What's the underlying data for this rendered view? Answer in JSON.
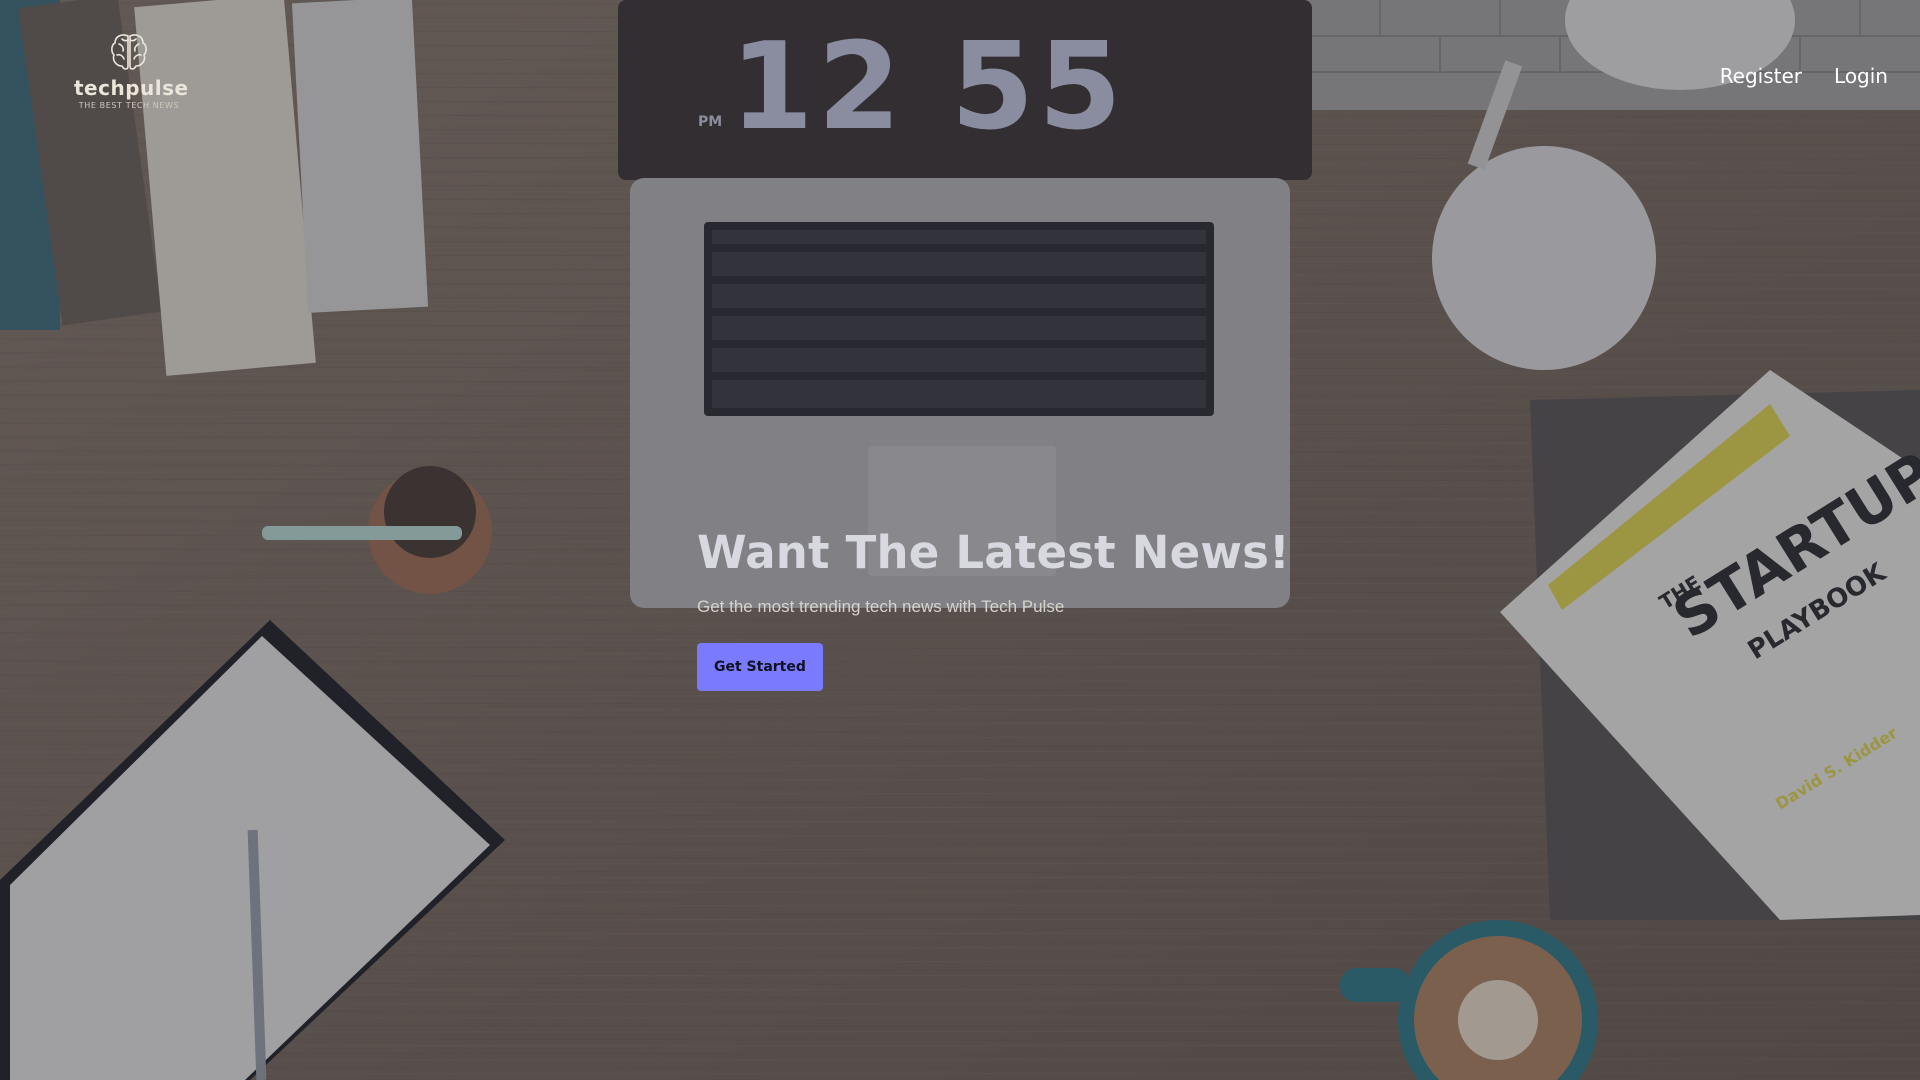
{
  "brand": {
    "name": "techpulse",
    "tagline": "THE BEST TECH NEWS",
    "icon": "brain-icon"
  },
  "nav": {
    "register_label": "Register",
    "login_label": "Login"
  },
  "hero": {
    "title": "Want The Latest News!",
    "subtitle": "Get the most trending tech news with Tech Pulse",
    "cta_label": "Get Started"
  },
  "background": {
    "laptop_clock": "12 55",
    "clock_period": "PM",
    "book_title": "THE STARTUP PLAYBOOK",
    "book_author": "David S. Kidder"
  },
  "colors": {
    "accent": "#7a7aff",
    "nav_text": "#ffffff",
    "title_text": "#d8d8e0"
  }
}
